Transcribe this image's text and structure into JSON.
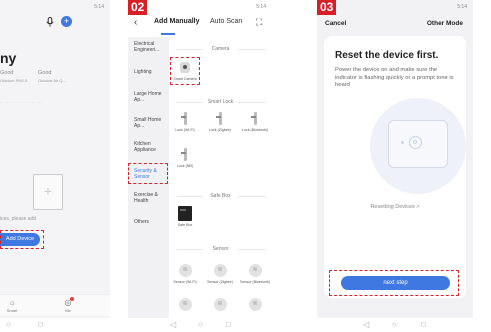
{
  "phone1": {
    "title": "ny",
    "weather": [
      {
        "value": "Good",
        "label": "Outdoor PM2.5"
      },
      {
        "value": "Good",
        "label": "Outdoor Air Q..."
      }
    ],
    "empty_text": "ices, please add",
    "add_button": "Add Device",
    "tabs": [
      {
        "label": "Smart",
        "icon": "smart-icon"
      },
      {
        "label": "Me",
        "icon": "me-icon"
      }
    ]
  },
  "phone2": {
    "step": "02",
    "status_time": "5:14",
    "tabs": {
      "manual": "Add Manually",
      "auto": "Auto Scan"
    },
    "categories": [
      "Electrical Engineeri...",
      "Lighting",
      "Large Home Ap...",
      "Small Home Ap...",
      "Kitchen Appliance",
      "Security & Sensor",
      "Exercise & Health",
      "Others"
    ],
    "active_category": "Security & Sensor",
    "sections": {
      "camera": "Camera",
      "smart_lock": "Smart Lock",
      "safe_box": "Safe Box",
      "sensor": "Sensor"
    },
    "camera_items": [
      "Smart Camera"
    ],
    "lock_items": [
      "Lock (Wi-Fi)",
      "Lock (Zigbee)",
      "Lock (Bluetooth)",
      "Lock (NB)"
    ],
    "safe_items": [
      "Safe Box"
    ],
    "sensor_items": [
      "Sensor (Wi-Fi)",
      "Sensor (Zigbee)",
      "Sensor (Bluetooth)"
    ]
  },
  "phone3": {
    "step": "03",
    "status_time": "5:14",
    "cancel": "Cancel",
    "other_mode": "Other Mode",
    "title": "Reset the device first.",
    "description": "Power the device on and make sure the indicator is flashing quickly or a prompt tone is heard",
    "resetting": "Resetting Devices >",
    "next_step": "next step"
  }
}
